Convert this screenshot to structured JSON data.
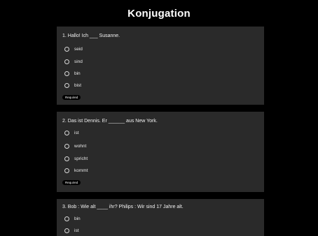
{
  "title": "Konjugation",
  "questions": [
    {
      "text": "1. Hallo! Ich ___ Susanne.",
      "options": [
        "seid",
        "sind",
        "bin",
        "bist"
      ],
      "required_label": "Required"
    },
    {
      "text": "2. Das ist Dennis. Er ______ aus New York.",
      "options": [
        "ist",
        "wohnt",
        "spricht",
        "kommt"
      ],
      "required_label": "Required"
    },
    {
      "text": "3. Bob : Wie alt ____ ihr? Philips : Wir sind 17 Jahre alt.",
      "options": [
        "bin",
        "ist"
      ]
    }
  ],
  "colors": {
    "background": "#000000",
    "card": "#2a2a2a",
    "text": "#ffffff"
  }
}
